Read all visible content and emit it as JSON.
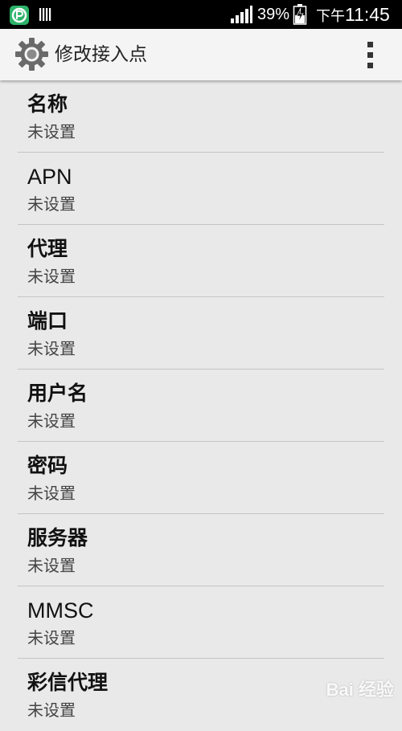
{
  "status_bar": {
    "battery_percent": "39%",
    "ampm": "下午",
    "time": "11:45",
    "icons": [
      "app-p-icon",
      "sim-icon",
      "signal-icon",
      "battery-charging-icon"
    ]
  },
  "action_bar": {
    "title": "修改接入点",
    "icons": [
      "settings-gear-icon",
      "overflow-menu-icon"
    ]
  },
  "settings": [
    {
      "title": "名称",
      "value": "未设置"
    },
    {
      "title": "APN",
      "value": "未设置"
    },
    {
      "title": "代理",
      "value": "未设置"
    },
    {
      "title": "端口",
      "value": "未设置"
    },
    {
      "title": "用户名",
      "value": "未设置"
    },
    {
      "title": "密码",
      "value": "未设置"
    },
    {
      "title": "服务器",
      "value": "未设置"
    },
    {
      "title": "MMSC",
      "value": "未设置"
    },
    {
      "title": "彩信代理",
      "value": "未设置"
    }
  ],
  "watermark": "Bai 经验",
  "colors": {
    "status_bar": "#000000",
    "action_bar": "#f4f4f4",
    "background": "#e9e9e9",
    "app_icon": "#2db36a"
  }
}
